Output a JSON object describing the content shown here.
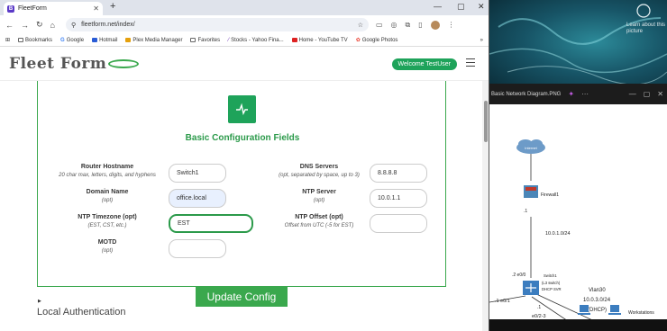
{
  "browser": {
    "tab_title": "FleetForm",
    "url": "fleetform.net/index/",
    "bookmarks": [
      "Bookmarks",
      "Google",
      "Hotmail",
      "Plex Media Manager",
      "Favorites",
      "Stocks - Yahoo Fina...",
      "Home - YouTube TV",
      "Google Photos"
    ]
  },
  "site": {
    "logo": "Fleet Form",
    "welcome_label": "Welcome TestUser"
  },
  "form": {
    "title": "Basic Configuration Fields",
    "fields": {
      "hostname": {
        "label": "Router Hostname",
        "sub": "20 char max, letters, digits, and hyphens",
        "value": "Switch1"
      },
      "domain": {
        "label": "Domain Name",
        "sub": "(opt)",
        "value": "office.local"
      },
      "timezone": {
        "label": "NTP Timezone (opt)",
        "sub": "(EST, CST, etc.)",
        "value": "EST"
      },
      "motd": {
        "label": "MOTD",
        "sub": "(opt)",
        "value": ""
      },
      "dns": {
        "label": "DNS Servers",
        "sub": "(opt, separated by space, up to 3)",
        "value": "8.8.8.8"
      },
      "ntp_server": {
        "label": "NTP Server",
        "sub": "(opt)",
        "value": "10.0.1.1"
      },
      "ntp_offset": {
        "label": "NTP Offset (opt)",
        "sub": "Offset from UTC (-5 for EST)",
        "value": ""
      }
    },
    "update_label": "Update Config",
    "section_local_auth": "Local Authentication"
  },
  "desktop": {
    "wallpaper_label": "Learn about this picture"
  },
  "viewer": {
    "title": "Basic Network Diagram.PNG",
    "nodes": {
      "cloud": "Internet",
      "firewall": "Firewall1",
      "fw_port": ".1",
      "subnet_top": "10.0.1.0/24",
      "switch_lines": [
        "Switch1",
        "(L3 switch)",
        "DHCP SVR"
      ],
      "sw_up": ".2 e0/0",
      "sw_left": ".1 e0/1",
      "sw_down": ".1",
      "sw_range": "e0/2-3",
      "vlan_lines": [
        "Vlan30",
        "10.0.3.0/24",
        "(DHCP)"
      ],
      "workstations": "Workstations"
    }
  }
}
